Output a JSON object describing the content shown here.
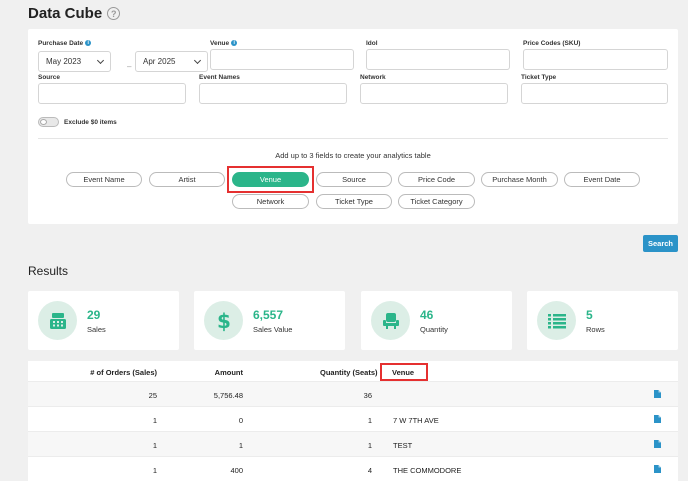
{
  "page": {
    "title": "Data Cube",
    "help_icon": "question-circle-icon"
  },
  "filters": {
    "purchase_date": {
      "label": "Purchase Date",
      "from": "May 2023",
      "to": "Apr 2025",
      "separator": "–"
    },
    "venue": {
      "label": "Venue",
      "value": ""
    },
    "idol": {
      "label": "Idol",
      "value": ""
    },
    "price_codes": {
      "label": "Price Codes (SKU)",
      "value": ""
    },
    "source": {
      "label": "Source",
      "value": ""
    },
    "event_names": {
      "label": "Event Names",
      "value": ""
    },
    "network": {
      "label": "Network",
      "value": ""
    },
    "ticket_type": {
      "label": "Ticket Type",
      "value": ""
    },
    "exclude_zero": {
      "label": "Exclude $0 items",
      "on": false
    }
  },
  "fields": {
    "hint": "Add up to 3 fields to create your analytics table",
    "items": [
      {
        "label": "Event Name",
        "active": false
      },
      {
        "label": "Artist",
        "active": false
      },
      {
        "label": "Venue",
        "active": true
      },
      {
        "label": "Source",
        "active": false
      },
      {
        "label": "Price Code",
        "active": false
      },
      {
        "label": "Purchase Month",
        "active": false
      },
      {
        "label": "Event Date",
        "active": false
      },
      {
        "label": "Network",
        "active": false
      },
      {
        "label": "Ticket Type",
        "active": false
      },
      {
        "label": "Ticket Category",
        "active": false
      }
    ]
  },
  "search_button": "Search",
  "results": {
    "title": "Results",
    "stats": [
      {
        "value": "29",
        "label": "Sales",
        "icon": "cash-register-icon"
      },
      {
        "value": "6,557",
        "label": "Sales Value",
        "icon": "dollar-icon"
      },
      {
        "value": "46",
        "label": "Quantity",
        "icon": "seat-icon"
      },
      {
        "value": "5",
        "label": "Rows",
        "icon": "list-icon"
      }
    ]
  },
  "table": {
    "headers": [
      "# of Orders (Sales)",
      "Amount",
      "Quantity (Seats)",
      "Venue"
    ],
    "rows": [
      [
        "25",
        "5,756.48",
        "36",
        ""
      ],
      [
        "1",
        "0",
        "1",
        "7 W 7TH AVE"
      ],
      [
        "1",
        "1",
        "1",
        "TEST"
      ],
      [
        "1",
        "400",
        "4",
        "THE COMMODORE"
      ]
    ],
    "row_icon": "document-icon"
  },
  "colors": {
    "accent_green": "#2bb58a",
    "accent_blue": "#2b93c8",
    "highlight_red": "#e53030"
  }
}
